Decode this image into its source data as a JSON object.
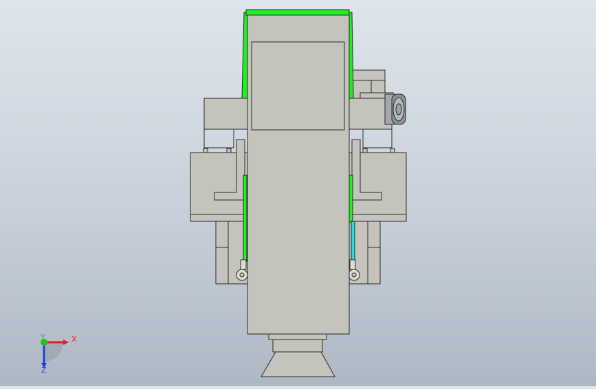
{
  "viewport": {
    "background_top": "#dfe5ec",
    "background_bottom": "#aeb8c4"
  },
  "model": {
    "body_color": "#c4c4bc",
    "edge_color": "#2a2a2a",
    "highlight_color": "#22ee22",
    "accent_color": "#22dddd",
    "motor_color": "#8c9296"
  },
  "triad": {
    "x_label": "X",
    "y_label": "Y",
    "z_label": "Z",
    "x_color": "#e02020",
    "y_color": "#20c020",
    "z_color": "#2040d0"
  }
}
